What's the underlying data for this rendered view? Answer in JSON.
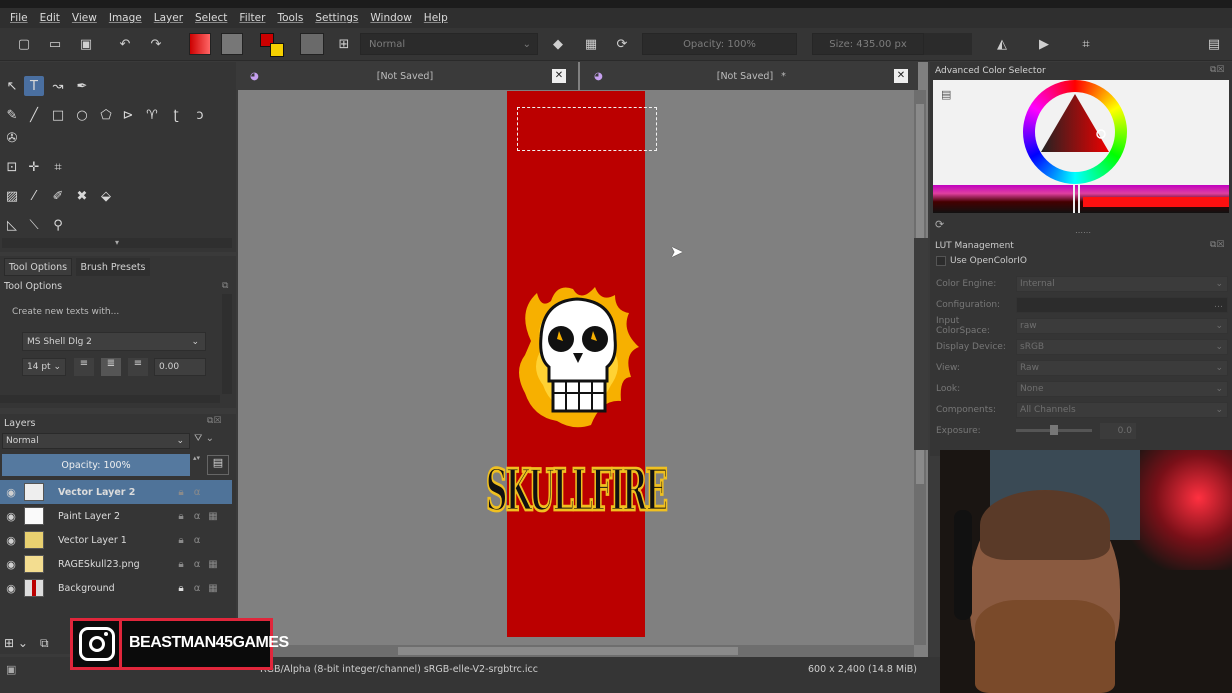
{
  "menu": [
    "File",
    "Edit",
    "View",
    "Image",
    "Layer",
    "Select",
    "Filter",
    "Tools",
    "Settings",
    "Window",
    "Help"
  ],
  "toolbar": {
    "blend_mode": "Normal",
    "opacity": "Opacity: 100%",
    "size": "Size: 435.00 px"
  },
  "tool_options": {
    "tabs": [
      "Tool Options",
      "Brush Presets"
    ],
    "section_title": "Tool Options",
    "create_text": "Create new texts with...",
    "font": "MS Shell Dlg 2",
    "font_size": "14 pt",
    "spacing": "0.00"
  },
  "layers": {
    "title": "Layers",
    "blend_mode": "Normal",
    "opacity": "Opacity:  100%",
    "items": [
      {
        "name": "Vector Layer 2"
      },
      {
        "name": "Paint Layer 2"
      },
      {
        "name": "Vector Layer 1"
      },
      {
        "name": "RAGESkull23.png"
      },
      {
        "name": "Background"
      }
    ]
  },
  "canvas": {
    "tabs": [
      {
        "title": "[Not Saved]",
        "modified": ""
      },
      {
        "title": "[Not Saved]",
        "modified": "*"
      }
    ],
    "artwork_text": "SKULLFIRE",
    "colors": {
      "banner": "#bb0000",
      "text_fill": "#111111",
      "text_outline": "#f0c020"
    }
  },
  "color_selector": {
    "title": "Advanced Color Selector"
  },
  "lut": {
    "title": "LUT Management",
    "use_ocio": "Use OpenColorIO",
    "rows": [
      {
        "label": "Color Engine:",
        "value": "Internal"
      },
      {
        "label": "Configuration:",
        "value": ""
      },
      {
        "label": "Input ColorSpace:",
        "value": "raw"
      },
      {
        "label": "Display Device:",
        "value": "sRGB"
      },
      {
        "label": "View:",
        "value": "Raw"
      },
      {
        "label": "Look:",
        "value": "None"
      },
      {
        "label": "Components:",
        "value": "All Channels"
      },
      {
        "label": "Exposure:",
        "value": "0.0"
      }
    ]
  },
  "status": {
    "colorspace": "RGB/Alpha (8-bit integer/channel)  sRGB-elle-V2-srgbtrc.icc",
    "dimensions": "600 x 2,400 (14.8 MiB)"
  },
  "instagram": {
    "handle": "BEASTMAN45GAMES"
  }
}
